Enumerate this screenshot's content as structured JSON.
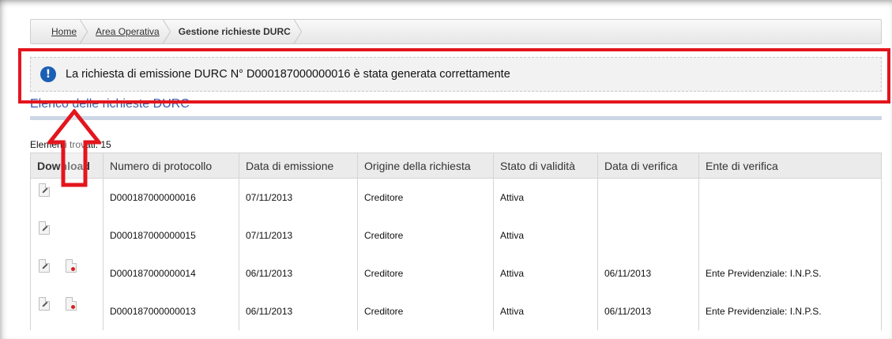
{
  "breadcrumb": {
    "items": [
      {
        "label": "Home"
      },
      {
        "label": "Area Operativa"
      },
      {
        "label": "Gestione richieste DURC"
      }
    ]
  },
  "notice": {
    "icon": "info-icon",
    "text": "La richiesta di emissione DURC N° D000187000000016 è stata generata correttamente"
  },
  "section": {
    "title": "Elenco delle richieste DURC"
  },
  "results": {
    "count_label": "Elementi trovati: 15"
  },
  "table": {
    "headers": {
      "download": "Download",
      "protocollo": "Numero di protocollo",
      "emissione": "Data di emissione",
      "origine": "Origine della richiesta",
      "stato": "Stato di validità",
      "verifica": "Data di verifica",
      "ente": "Ente di verifica"
    },
    "rows": [
      {
        "protocollo": "D000187000000016",
        "emissione": "07/11/2013",
        "origine": "Creditore",
        "stato": "Attiva",
        "verifica": "",
        "ente": ""
      },
      {
        "protocollo": "D000187000000015",
        "emissione": "07/11/2013",
        "origine": "Creditore",
        "stato": "Attiva",
        "verifica": "",
        "ente": ""
      },
      {
        "protocollo": "D000187000000014",
        "emissione": "06/11/2013",
        "origine": "Creditore",
        "stato": "Attiva",
        "verifica": "06/11/2013",
        "ente": "Ente Previdenziale: I.N.P.S."
      },
      {
        "protocollo": "D000187000000013",
        "emissione": "06/11/2013",
        "origine": "Creditore",
        "stato": "Attiva",
        "verifica": "06/11/2013",
        "ente": "Ente Previdenziale: I.N.P.S."
      }
    ]
  },
  "colors": {
    "highlight": "#e3151d",
    "info": "#1b5fb5",
    "section_title": "#3b5aa6"
  }
}
